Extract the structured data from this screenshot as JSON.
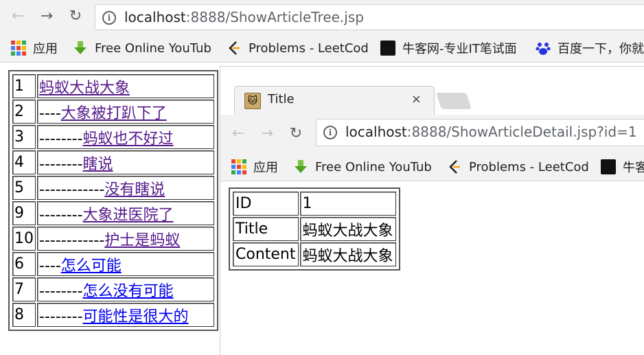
{
  "outer": {
    "url_host": "localhost",
    "url_rest": ":8888/ShowArticleTree.jsp",
    "bookmarks": [
      {
        "label": "应用",
        "icon": "apps-grid-icon"
      },
      {
        "label": "Free Online YouTub",
        "icon": "download-arrow-icon"
      },
      {
        "label": "Problems - LeetCod",
        "icon": "leetcode-icon"
      },
      {
        "label": "牛客网-专业IT笔试面",
        "icon": "nowcoder-icon"
      },
      {
        "label": "百度一下，你就",
        "icon": "baidu-paw-icon"
      }
    ]
  },
  "tree": {
    "rows": [
      {
        "id": "1",
        "prefix": "",
        "title": "蚂蚁大战大象",
        "visited": true
      },
      {
        "id": "2",
        "prefix": "----",
        "title": "大象被打趴下了",
        "visited": true
      },
      {
        "id": "3",
        "prefix": "--------",
        "title": "蚂蚁也不好过",
        "visited": true
      },
      {
        "id": "4",
        "prefix": "--------",
        "title": "瞎说",
        "visited": true
      },
      {
        "id": "5",
        "prefix": "------------",
        "title": "没有瞎说",
        "visited": true
      },
      {
        "id": "9",
        "prefix": "--------",
        "title": "大象进医院了",
        "visited": true
      },
      {
        "id": "10",
        "prefix": "------------",
        "title": "护士是蚂蚁",
        "visited": true
      },
      {
        "id": "6",
        "prefix": "----",
        "title": "怎么可能",
        "visited": false
      },
      {
        "id": "7",
        "prefix": "--------",
        "title": "怎么没有可能",
        "visited": false
      },
      {
        "id": "8",
        "prefix": "--------",
        "title": "可能性是很大的",
        "visited": false
      }
    ]
  },
  "inner": {
    "tab_title": "Title",
    "tab_close": "×",
    "url_host": "localhost",
    "url_rest": ":8888/ShowArticleDetail.jsp?id=1",
    "bookmarks": [
      {
        "label": "应用",
        "icon": "apps-grid-icon"
      },
      {
        "label": "Free Online YouTub",
        "icon": "download-arrow-icon"
      },
      {
        "label": "Problems - LeetCod",
        "icon": "leetcode-icon"
      },
      {
        "label": "牛客",
        "icon": "nowcoder-icon"
      }
    ],
    "detail": [
      {
        "key": "ID",
        "value": "1"
      },
      {
        "key": "Title",
        "value": "蚂蚁大战大象"
      },
      {
        "key": "Content",
        "value": "蚂蚁大战大象"
      }
    ]
  },
  "colors": {
    "visited_link": "#551a8b",
    "unvisited_link": "#0000ee",
    "chrome_bg": "#f2f2f2"
  }
}
